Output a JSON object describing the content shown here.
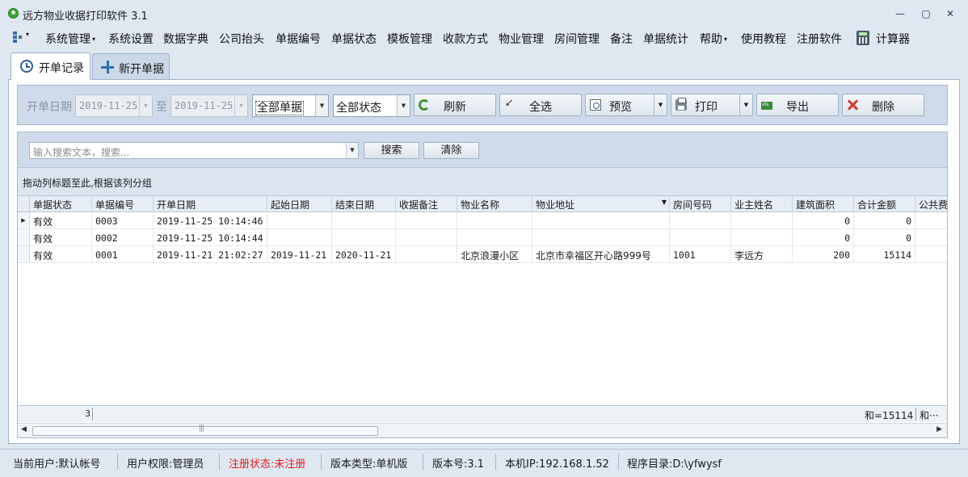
{
  "window": {
    "title": "远方物业收据打印软件 3.1",
    "min_symbol": "—",
    "max_symbol": "▢",
    "close_symbol": "✕"
  },
  "menu": {
    "items": [
      {
        "label": "系统管理",
        "dropdown": true
      },
      {
        "label": "系统设置",
        "dropdown": false
      },
      {
        "label": "数据字典",
        "dropdown": false
      },
      {
        "label": "公司抬头",
        "dropdown": false
      },
      {
        "label": "单据编号",
        "dropdown": false
      },
      {
        "label": "单据状态",
        "dropdown": false
      },
      {
        "label": "模板管理",
        "dropdown": false
      },
      {
        "label": "收款方式",
        "dropdown": false
      },
      {
        "label": "物业管理",
        "dropdown": false
      },
      {
        "label": "房间管理",
        "dropdown": false
      },
      {
        "label": "备注",
        "dropdown": false
      },
      {
        "label": "单据统计",
        "dropdown": false
      },
      {
        "label": "帮助",
        "dropdown": true
      },
      {
        "label": "使用教程",
        "dropdown": false
      },
      {
        "label": "注册软件",
        "dropdown": false
      },
      {
        "label": "计算器",
        "dropdown": false
      }
    ]
  },
  "tabs": [
    {
      "label": "开单记录",
      "icon": "clock-icon",
      "active": true
    },
    {
      "label": "新开单据",
      "icon": "plus-icon",
      "active": false
    }
  ],
  "filter": {
    "date_label": "开单日期",
    "to_label": "至",
    "date_from": "2019-11-25",
    "date_to": "2019-11-25",
    "type_select": "全部单据",
    "status_select": "全部状态",
    "buttons": {
      "refresh": "刷新",
      "select_all": "全选",
      "preview": "预览",
      "print": "打印",
      "export": "导出",
      "delete": "删除"
    }
  },
  "search": {
    "placeholder": "输入搜索文本，搜索...",
    "search_button": "搜索",
    "clear_button": "清除"
  },
  "grid": {
    "group_hint": "拖动列标题至此,根据该列分组",
    "columns": [
      "单据状态",
      "单据编号",
      "开单日期",
      "起始日期",
      "结束日期",
      "收据备注",
      "物业名称",
      "物业地址",
      "房间号码",
      "业主姓名",
      "建筑面积",
      "合计金额",
      "公共费"
    ],
    "rows": [
      [
        "有效",
        "0003",
        "2019-11-25 10:14:46",
        "",
        "",
        "",
        "",
        "",
        "",
        "",
        "0",
        "0",
        ""
      ],
      [
        "有效",
        "0002",
        "2019-11-25 10:14:44",
        "",
        "",
        "",
        "",
        "",
        "",
        "",
        "0",
        "0",
        ""
      ],
      [
        "有效",
        "0001",
        "2019-11-21 21:02:27",
        "2019-11-21",
        "2020-11-21",
        "",
        "北京浪漫小区",
        "北京市幸福区开心路999号",
        "1001",
        "李远方",
        "200",
        "15114",
        ""
      ]
    ],
    "footer": {
      "count": "3",
      "sum": "和=15114",
      "sum_more": "和···"
    }
  },
  "status": {
    "user": "当前用户:默认帐号",
    "permission": "用户权限:管理员",
    "register": "注册状态:未注册",
    "edition": "版本类型:单机版",
    "version": "版本号:3.1",
    "ip": "本机IP:192.168.1.52",
    "dir": "程序目录:D:\\yfwysf"
  },
  "colors": {
    "accent": "#2c5f99",
    "alert": "#e01c1c",
    "panel": "#cfdbea"
  }
}
